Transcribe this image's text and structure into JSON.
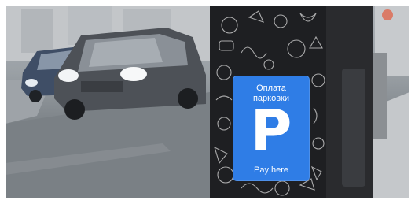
{
  "parking_sign": {
    "title_line1": "Оплата",
    "title_line2": "парковки",
    "letter": "P",
    "footer": "Pay here"
  },
  "colors": {
    "sign_blue": "#2f7de6",
    "meter_body": "#1e1f22",
    "car": "#4d5157",
    "road": "#7e8489"
  }
}
